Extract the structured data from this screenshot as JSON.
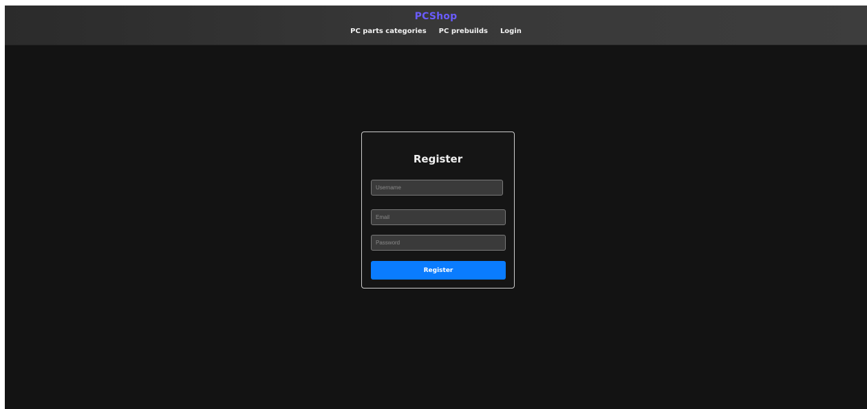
{
  "header": {
    "brand": "PCShop",
    "nav": [
      {
        "label": "PC parts categories"
      },
      {
        "label": "PC prebuilds"
      },
      {
        "label": "Login"
      }
    ]
  },
  "register_form": {
    "title": "Register",
    "username": {
      "value": "",
      "placeholder": "Username"
    },
    "email": {
      "value": "",
      "placeholder": "Email"
    },
    "password": {
      "value": "",
      "placeholder": "Password"
    },
    "submit_label": "Register"
  },
  "colors": {
    "brand": "#6a5cff",
    "page_background": "#131313",
    "header_background": "#383838",
    "primary_button": "#0a7cff"
  }
}
